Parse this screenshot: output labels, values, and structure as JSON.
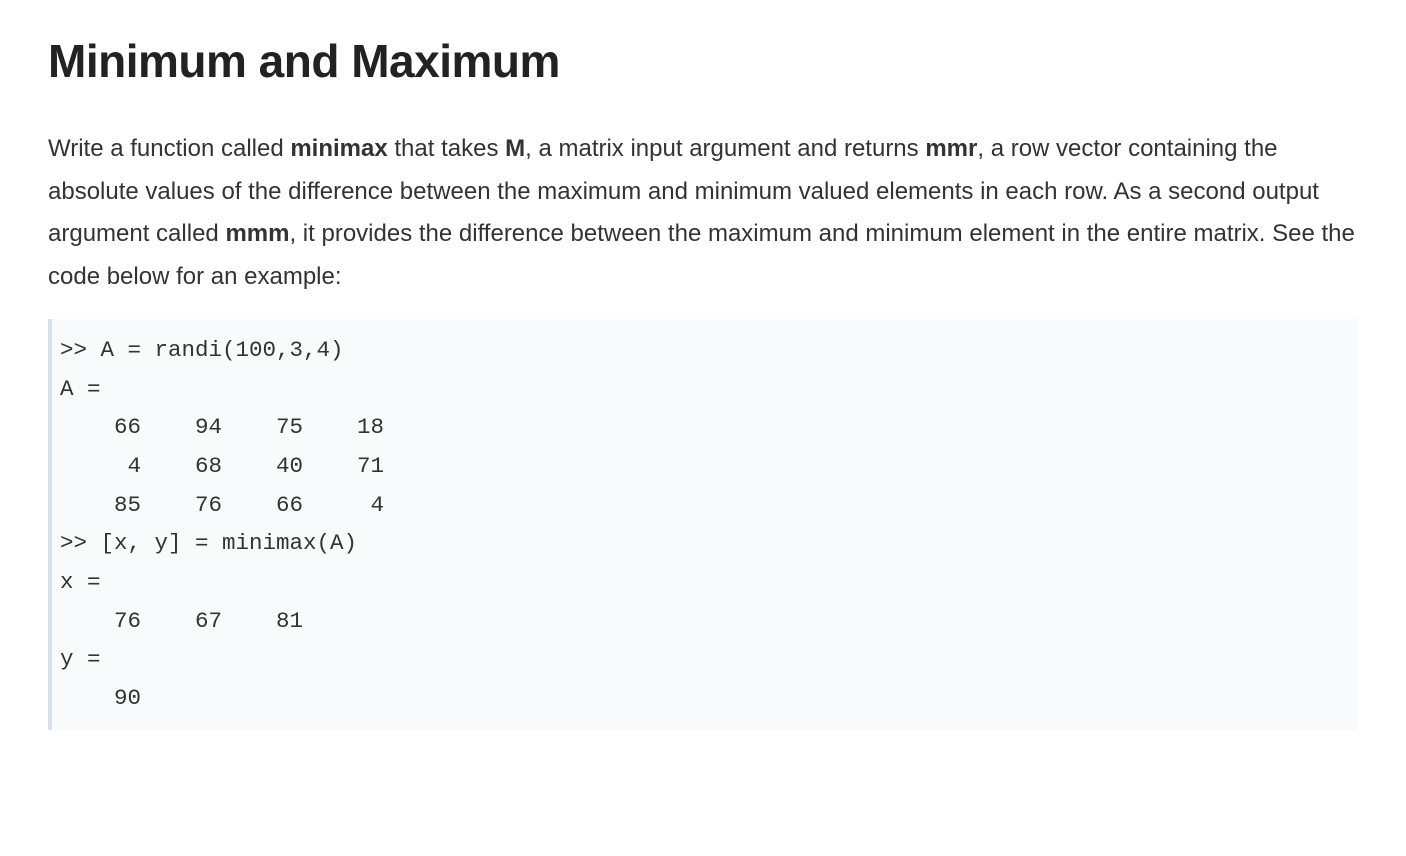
{
  "title": "Minimum and Maximum",
  "paragraph": {
    "p1": "Write a function called ",
    "b1": "minimax",
    "p2": " that takes ",
    "b2": "M",
    "p3": ", a matrix input argument and returns ",
    "b3": "mmr",
    "p4": ", a row vector containing the absolute values of the difference between the maximum and minimum valued elements in each row. As a second output argument called ",
    "b4": "mmm",
    "p5": ", it provides the difference between the maximum and minimum element in the entire matrix. See the code below for an example:"
  },
  "code": ">> A = randi(100,3,4)\nA =\n    66    94    75    18\n     4    68    40    71\n    85    76    66     4\n>> [x, y] = minimax(A)\nx =\n    76    67    81\ny =\n    90"
}
